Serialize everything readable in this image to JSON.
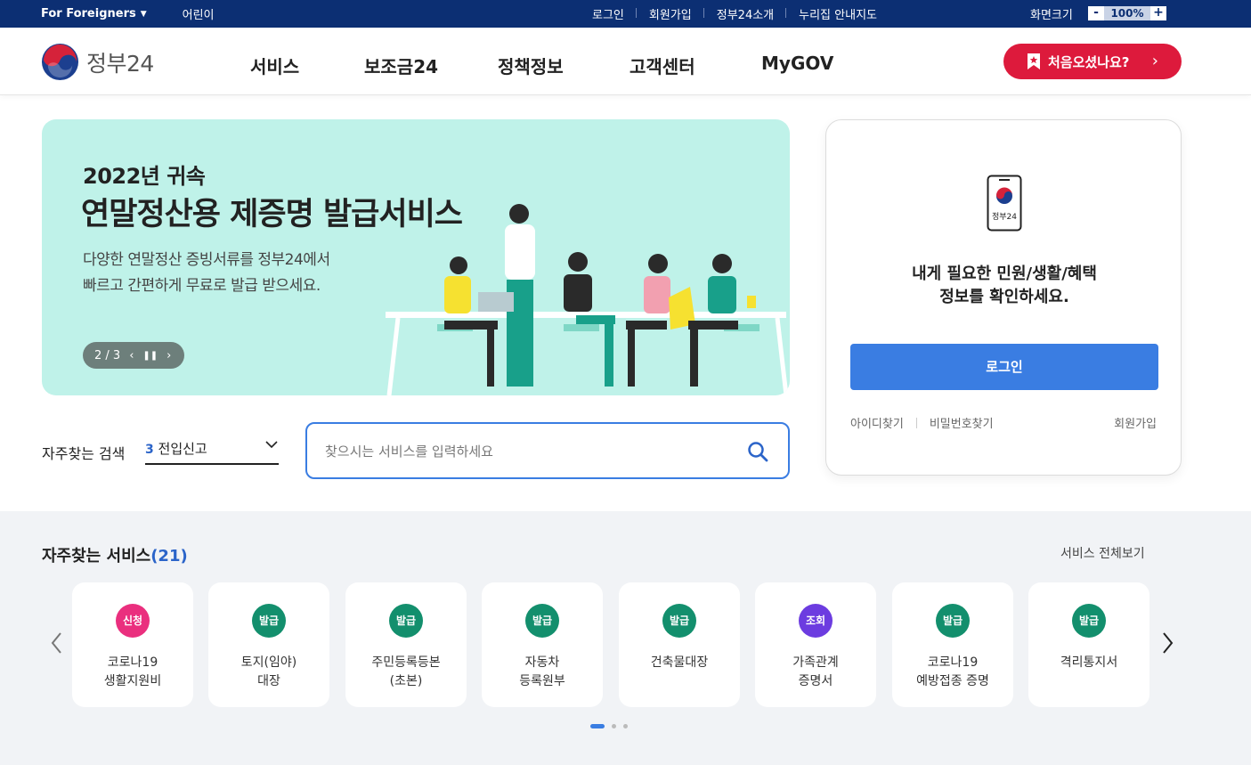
{
  "topbar": {
    "foreigners": "For Foreigners",
    "kids": "어린이",
    "links": [
      "로그인",
      "회원가입",
      "정부24소개",
      "누리집 안내지도"
    ],
    "zoom_label": "화면크기",
    "zoom_minus": "-",
    "zoom_value": "100%",
    "zoom_plus": "+"
  },
  "header": {
    "logo_text": "정부24",
    "nav": [
      "서비스",
      "보조금24",
      "정책정보",
      "고객센터",
      "MyGOV"
    ],
    "cta": "처음오셨나요?"
  },
  "banner": {
    "subtitle": "2022년 귀속",
    "title": "연말정산용 제증명 발급서비스",
    "desc_line1": "다양한 연말정산 증빙서류를 정부24에서",
    "desc_line2": "빠르고 간편하게 무료로 발급 받으세요.",
    "pager": "2 / 3"
  },
  "login_card": {
    "phone_label": "정부24",
    "msg_line1": "내게 필요한 민원/생활/혜택",
    "msg_line2": "정보를 확인하세요.",
    "login_button": "로그인",
    "find_id": "아이디찾기",
    "find_pw": "비밀번호찾기",
    "join": "회원가입"
  },
  "search": {
    "label": "자주찾는 검색",
    "selected_num": "3",
    "selected_text": "전입신고",
    "placeholder": "찾으시는 서비스를 입력하세요"
  },
  "services": {
    "title": "자주찾는 서비스",
    "count": "(21)",
    "view_all": "서비스 전체보기",
    "items": [
      {
        "badge": "신청",
        "color": "#ea2f7e",
        "line1": "코로나19",
        "line2": "생활지원비"
      },
      {
        "badge": "발급",
        "color": "#138f6d",
        "line1": "토지(임야)",
        "line2": "대장"
      },
      {
        "badge": "발급",
        "color": "#138f6d",
        "line1": "주민등록등본",
        "line2": "(초본)"
      },
      {
        "badge": "발급",
        "color": "#138f6d",
        "line1": "자동차",
        "line2": "등록원부"
      },
      {
        "badge": "발급",
        "color": "#138f6d",
        "line1": "건축물대장",
        "line2": ""
      },
      {
        "badge": "조회",
        "color": "#6c3ce0",
        "line1": "가족관계",
        "line2": "증명서"
      },
      {
        "badge": "발급",
        "color": "#138f6d",
        "line1": "코로나19",
        "line2": "예방접종 증명"
      },
      {
        "badge": "발급",
        "color": "#138f6d",
        "line1": "격리통지서",
        "line2": ""
      }
    ]
  },
  "colors": {
    "navy": "#0c2f73",
    "accent_blue": "#3a7de2",
    "cta_red": "#dd1a3c",
    "banner_mint": "#bff2e9"
  }
}
